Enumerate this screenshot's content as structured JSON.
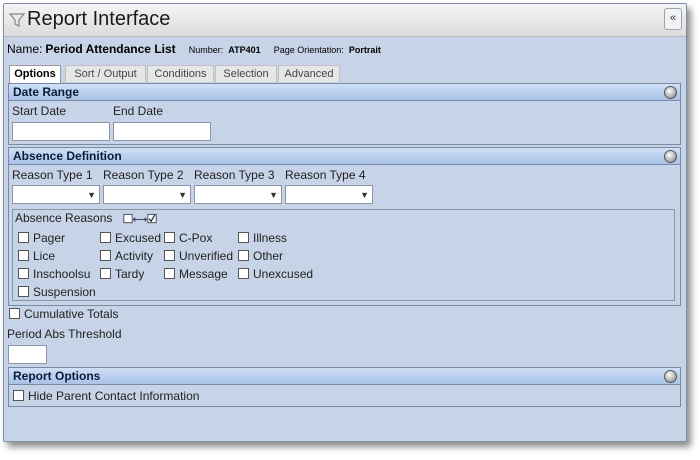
{
  "window": {
    "title": "Report Interface",
    "collapse_glyph": "«"
  },
  "report": {
    "name_label": "Name:",
    "name_value": "Period Attendance List",
    "number_label": "Number:",
    "number_value": "ATP401",
    "orientation_label": "Page Orientation:",
    "orientation_value": "Portrait"
  },
  "tabs": [
    {
      "label": "Options",
      "active": true
    },
    {
      "label": "Sort / Output",
      "active": false
    },
    {
      "label": "Conditions",
      "active": false
    },
    {
      "label": "Selection",
      "active": false
    },
    {
      "label": "Advanced",
      "active": false
    }
  ],
  "date_range": {
    "title": "Date Range",
    "start_label": "Start Date",
    "start_value": "",
    "end_label": "End Date",
    "end_value": ""
  },
  "absence_definition": {
    "title": "Absence Definition",
    "reason_types": [
      {
        "label": "Reason Type 1",
        "value": ""
      },
      {
        "label": "Reason Type 2",
        "value": ""
      },
      {
        "label": "Reason Type 3",
        "value": ""
      },
      {
        "label": "Reason Type 4",
        "value": ""
      }
    ],
    "reasons_label": "Absence Reasons",
    "reasons": [
      "Pager",
      "Excused",
      "C-Pox",
      "Illness",
      "Lice",
      "Activity",
      "Unverified",
      "Other",
      "Inschoolsu",
      "Tardy",
      "Message",
      "Unexcused",
      "Suspension"
    ]
  },
  "cumulative_totals_label": "Cumulative Totals",
  "threshold": {
    "label": "Period Abs Threshold",
    "value": ""
  },
  "report_options": {
    "title": "Report Options",
    "hide_parent_label": "Hide Parent Contact Information"
  },
  "icons": {
    "title": "funnel-icon",
    "collapse": "double-chevron-left-icon",
    "calendar": "calendar-icon",
    "section_toggle": "circle-toggle-icon",
    "select_all": "select-all-icon"
  },
  "colors": {
    "panel_bg": "#c7d3e6",
    "section_header": "#a9c3e8",
    "border": "#7a8aa3"
  }
}
